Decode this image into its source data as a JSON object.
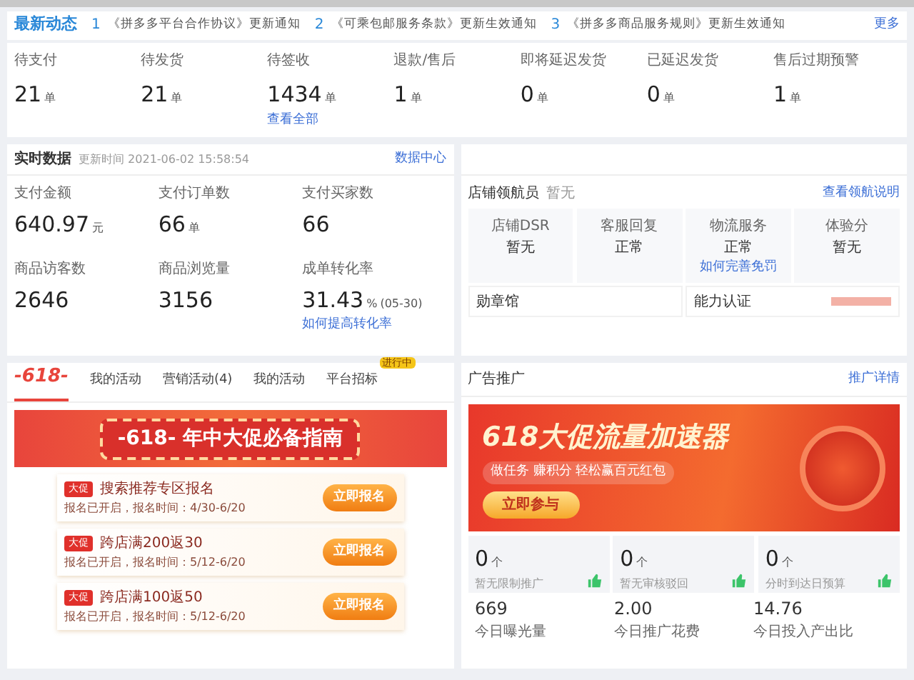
{
  "notices": {
    "title": "最新动态",
    "more": "更多",
    "items": [
      {
        "index": "1",
        "text": "《拼多多平台合作协议》更新通知"
      },
      {
        "index": "2",
        "text": "《可乘包邮服务条款》更新生效通知"
      },
      {
        "index": "3",
        "text": "《拼多多商品服务规则》更新生效通知"
      }
    ]
  },
  "order_stats": [
    {
      "label": "待支付",
      "value": "21",
      "unit": "单"
    },
    {
      "label": "待发货",
      "value": "21",
      "unit": "单"
    },
    {
      "label": "待签收",
      "value": "1434",
      "unit": "单",
      "link": "查看全部"
    },
    {
      "label": "退款/售后",
      "value": "1",
      "unit": "单"
    },
    {
      "label": "即将延迟发货",
      "value": "0",
      "unit": "单"
    },
    {
      "label": "已延迟发货",
      "value": "0",
      "unit": "单"
    },
    {
      "label": "售后过期预警",
      "value": "1",
      "unit": "单"
    }
  ],
  "realtime": {
    "title": "实时数据",
    "updated": "更新时间 2021-06-02 15:58:54",
    "link": "数据中心",
    "metrics": [
      {
        "label": "支付金额",
        "value": "640.97",
        "unit": "元"
      },
      {
        "label": "支付订单数",
        "value": "66",
        "unit": "单"
      },
      {
        "label": "支付买家数",
        "value": "66"
      },
      {
        "label": "商品访客数",
        "value": "2646"
      },
      {
        "label": "商品浏览量",
        "value": "3156"
      },
      {
        "label": "成单转化率",
        "value": "31.43",
        "unit": "%",
        "note": "(05-30)",
        "link": "如何提高转化率"
      }
    ]
  },
  "store": {
    "navigator_label": "店铺领航员",
    "navigator_value": "暂无",
    "link": "查看领航说明",
    "scores": [
      {
        "label": "店铺DSR",
        "value": "暂无"
      },
      {
        "label": "客服回复",
        "value": "正常"
      },
      {
        "label": "物流服务",
        "value": "正常",
        "link": "如何完善免罚"
      },
      {
        "label": "体验分",
        "value": "暂无"
      }
    ],
    "medal_label": "勋章馆",
    "cert_label": "能力认证"
  },
  "activities": {
    "tabs": [
      {
        "label": "-618-",
        "kind": "logo",
        "selected": true
      },
      {
        "label": "我的活动",
        "kind": "text",
        "selected": false
      },
      {
        "label": "营销活动(4)",
        "kind": "text",
        "selected": false
      },
      {
        "label": "我的活动",
        "kind": "text",
        "selected": false
      },
      {
        "label": "平台招标",
        "kind": "text",
        "selected": false,
        "badge": "进行中"
      }
    ],
    "banner": {
      "logo": "-618-",
      "text": "年中大促必备指南"
    },
    "items": [
      {
        "tag": "大促",
        "title": "搜索推荐专区报名",
        "subtitle": "报名已开启，报名时间：4/30-6/20",
        "button": "立即报名"
      },
      {
        "tag": "大促",
        "title": "跨店满200返30",
        "subtitle": "报名已开启，报名时间：5/12-6/20",
        "button": "立即报名"
      },
      {
        "tag": "大促",
        "title": "跨店满100返50",
        "subtitle": "报名已开启，报名时间：5/12-6/20",
        "button": "立即报名"
      }
    ]
  },
  "ads": {
    "title": "广告推广",
    "link": "推广详情",
    "banner": {
      "title": "618大促流量加速器",
      "subtitle": "做任务 赚积分 轻松赢百元红包",
      "button": "立即参与"
    },
    "counters": [
      {
        "value": "0",
        "unit": "个",
        "label": "暂无限制推广"
      },
      {
        "value": "0",
        "unit": "个",
        "label": "暂无审核驳回"
      },
      {
        "value": "0",
        "unit": "个",
        "label": "分时到达日预算"
      }
    ],
    "metrics": [
      {
        "value": "669",
        "label": "今日曝光量"
      },
      {
        "value": "2.00",
        "label": "今日推广花费"
      },
      {
        "value": "14.76",
        "label": "今日投入产出比"
      }
    ]
  }
}
